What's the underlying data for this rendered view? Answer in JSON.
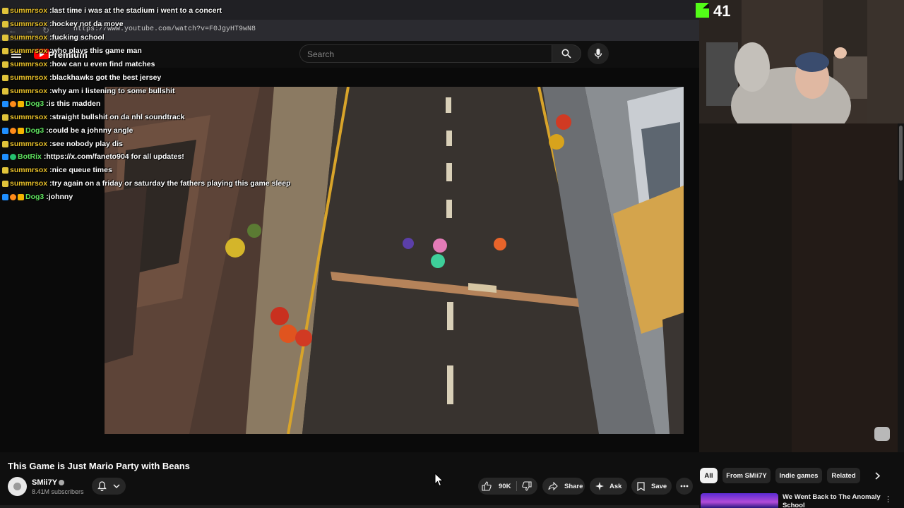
{
  "browser": {
    "url": "https://www.youtube.com/watch?v=F0JgyHT9wN8"
  },
  "youtube_header": {
    "logo_label": "Premium",
    "search_placeholder": "Search"
  },
  "stream_overlay": {
    "kick_viewer_count": "41",
    "chat": [
      {
        "user": "summrsox",
        "badges": [
          "ticket"
        ],
        "name_color": "#e8c02a",
        "message": "last time i was at the stadium i went to a concert"
      },
      {
        "user": "summrsox",
        "badges": [
          "ticket"
        ],
        "name_color": "#e8c02a",
        "message": "hockey not da move"
      },
      {
        "user": "summrsox",
        "badges": [
          "ticket"
        ],
        "name_color": "#e8c02a",
        "message": "fucking school"
      },
      {
        "user": "summrsox",
        "badges": [
          "ticket"
        ],
        "name_color": "#e8c02a",
        "message": "who plays this game man"
      },
      {
        "user": "summrsox",
        "badges": [
          "ticket"
        ],
        "name_color": "#e8c02a",
        "message": "how can u even find matches"
      },
      {
        "user": "summrsox",
        "badges": [
          "ticket"
        ],
        "name_color": "#e8c02a",
        "message": "blackhawks got the best jersey"
      },
      {
        "user": "summrsox",
        "badges": [
          "ticket"
        ],
        "name_color": "#e8c02a",
        "message": "why am i listening to some bullshit"
      },
      {
        "user": "Dog3",
        "badges": [
          "blue",
          "orange",
          "yellow"
        ],
        "name_color": "#5ee05e",
        "message": "is this madden"
      },
      {
        "user": "summrsox",
        "badges": [
          "ticket"
        ],
        "name_color": "#e8c02a",
        "message": "straight bullshit on da nhl soundtrack"
      },
      {
        "user": "Dog3",
        "badges": [
          "blue",
          "orange",
          "yellow"
        ],
        "name_color": "#5ee05e",
        "message": "could be a johnny angle"
      },
      {
        "user": "summrsox",
        "badges": [
          "ticket"
        ],
        "name_color": "#e8c02a",
        "message": "see nobody play dis"
      },
      {
        "user": "BotRix",
        "badges": [
          "blue",
          "green"
        ],
        "name_color": "#5ee05e",
        "message": "https://x.com/faneto904 for all updates!"
      },
      {
        "user": "summrsox",
        "badges": [
          "ticket"
        ],
        "name_color": "#e8c02a",
        "message": "nice queue times"
      },
      {
        "user": "summrsox",
        "badges": [
          "ticket"
        ],
        "name_color": "#e8c02a",
        "message": "try again on a friday or saturday the fathers playing this game sleep"
      },
      {
        "user": "Dog3",
        "badges": [
          "blue",
          "orange",
          "yellow"
        ],
        "name_color": "#5ee05e",
        "message": "johnny"
      }
    ]
  },
  "video": {
    "title": "This Game is Just Mario Party with Beans",
    "channel": "SMii7Y",
    "subscribers": "8.41M subscribers",
    "likes": "90K",
    "share_label": "Share",
    "ask_label": "Ask",
    "save_label": "Save"
  },
  "filter_chips": [
    "All",
    "From SMii7Y",
    "Indie games",
    "Related"
  ],
  "recommendation": {
    "title": "We Went Back to The Anomaly School"
  },
  "colors": {
    "kick_green": "#53fc18",
    "youtube_red": "#ff0000",
    "background": "#0f0f0f"
  }
}
